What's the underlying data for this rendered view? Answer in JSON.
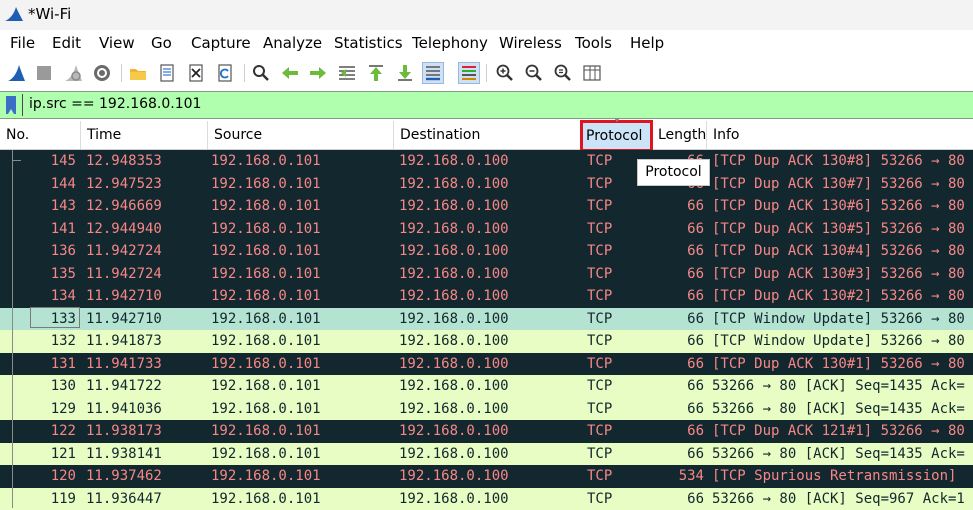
{
  "window": {
    "title": "*Wi-Fi"
  },
  "menu": [
    "File",
    "Edit",
    "View",
    "Go",
    "Capture",
    "Analyze",
    "Statistics",
    "Telephony",
    "Wireless",
    "Tools",
    "Help"
  ],
  "toolbar": {
    "icons": [
      "shark-fin-start-icon",
      "stop-capture-icon",
      "restart-capture-icon",
      "capture-options-icon",
      "open-file-icon",
      "save-file-icon",
      "close-file-icon",
      "reload-file-icon",
      "find-packet-icon",
      "go-back-icon",
      "go-forward-icon",
      "go-to-packet-icon",
      "go-first-icon",
      "go-last-icon",
      "autoscroll-icon",
      "colorize-icon",
      "zoom-in-icon",
      "zoom-out-icon",
      "zoom-normal-icon",
      "resize-columns-icon"
    ],
    "selected": [
      "autoscroll-icon",
      "colorize-icon"
    ]
  },
  "filter": {
    "value": "ip.src == 192.168.0.101",
    "bar_color": "#afffaf"
  },
  "columns": {
    "no": "No.",
    "time": "Time",
    "source": "Source",
    "destination": "Destination",
    "protocol": "Protocol",
    "length": "Length",
    "info": "Info"
  },
  "tooltip": "Protocol",
  "colors": {
    "dark_row_bg": "#12272e",
    "dark_row_fg": "#f78787",
    "light_row_bg": "#e7fdc3",
    "selected_row_bg": "#b5e3d2",
    "highlight_border": "#e0141e"
  },
  "packets": [
    {
      "no": "145",
      "time": "12.948353",
      "src": "192.168.0.101",
      "dst": "192.168.0.100",
      "proto": "TCP",
      "len": "66",
      "info": "[TCP Dup ACK 130#8] 53266 → 80",
      "style": "dark"
    },
    {
      "no": "144",
      "time": "12.947523",
      "src": "192.168.0.101",
      "dst": "192.168.0.100",
      "proto": "TCP",
      "len": "66",
      "info": "[TCP Dup ACK 130#7] 53266 → 80",
      "style": "dark"
    },
    {
      "no": "143",
      "time": "12.946669",
      "src": "192.168.0.101",
      "dst": "192.168.0.100",
      "proto": "TCP",
      "len": "66",
      "info": "[TCP Dup ACK 130#6] 53266 → 80",
      "style": "dark"
    },
    {
      "no": "141",
      "time": "12.944940",
      "src": "192.168.0.101",
      "dst": "192.168.0.100",
      "proto": "TCP",
      "len": "66",
      "info": "[TCP Dup ACK 130#5] 53266 → 80",
      "style": "dark"
    },
    {
      "no": "136",
      "time": "11.942724",
      "src": "192.168.0.101",
      "dst": "192.168.0.100",
      "proto": "TCP",
      "len": "66",
      "info": "[TCP Dup ACK 130#4] 53266 → 80",
      "style": "dark"
    },
    {
      "no": "135",
      "time": "11.942724",
      "src": "192.168.0.101",
      "dst": "192.168.0.100",
      "proto": "TCP",
      "len": "66",
      "info": "[TCP Dup ACK 130#3] 53266 → 80",
      "style": "dark"
    },
    {
      "no": "134",
      "time": "11.942710",
      "src": "192.168.0.101",
      "dst": "192.168.0.100",
      "proto": "TCP",
      "len": "66",
      "info": "[TCP Dup ACK 130#2] 53266 → 80",
      "style": "dark"
    },
    {
      "no": "133",
      "time": "11.942710",
      "src": "192.168.0.101",
      "dst": "192.168.0.100",
      "proto": "TCP",
      "len": "66",
      "info": "[TCP Window Update] 53266 → 80",
      "style": "sel"
    },
    {
      "no": "132",
      "time": "11.941873",
      "src": "192.168.0.101",
      "dst": "192.168.0.100",
      "proto": "TCP",
      "len": "66",
      "info": "[TCP Window Update] 53266 → 80",
      "style": "light"
    },
    {
      "no": "131",
      "time": "11.941733",
      "src": "192.168.0.101",
      "dst": "192.168.0.100",
      "proto": "TCP",
      "len": "66",
      "info": "[TCP Dup ACK 130#1] 53266 → 80",
      "style": "dark"
    },
    {
      "no": "130",
      "time": "11.941722",
      "src": "192.168.0.101",
      "dst": "192.168.0.100",
      "proto": "TCP",
      "len": "66",
      "info": "53266 → 80 [ACK] Seq=1435 Ack=",
      "style": "light"
    },
    {
      "no": "129",
      "time": "11.941036",
      "src": "192.168.0.101",
      "dst": "192.168.0.100",
      "proto": "TCP",
      "len": "66",
      "info": "53266 → 80 [ACK] Seq=1435 Ack=",
      "style": "light"
    },
    {
      "no": "122",
      "time": "11.938173",
      "src": "192.168.0.101",
      "dst": "192.168.0.100",
      "proto": "TCP",
      "len": "66",
      "info": "[TCP Dup ACK 121#1] 53266 → 80",
      "style": "dark"
    },
    {
      "no": "121",
      "time": "11.938141",
      "src": "192.168.0.101",
      "dst": "192.168.0.100",
      "proto": "TCP",
      "len": "66",
      "info": "53266 → 80 [ACK] Seq=1435 Ack=",
      "style": "light"
    },
    {
      "no": "120",
      "time": "11.937462",
      "src": "192.168.0.101",
      "dst": "192.168.0.100",
      "proto": "TCP",
      "len": "534",
      "info": "[TCP Spurious Retransmission]",
      "style": "dark"
    },
    {
      "no": "119",
      "time": "11.936447",
      "src": "192.168.0.101",
      "dst": "192.168.0.100",
      "proto": "TCP",
      "len": "66",
      "info": "53266 → 80 [ACK] Seq=967 Ack=1",
      "style": "light"
    }
  ]
}
